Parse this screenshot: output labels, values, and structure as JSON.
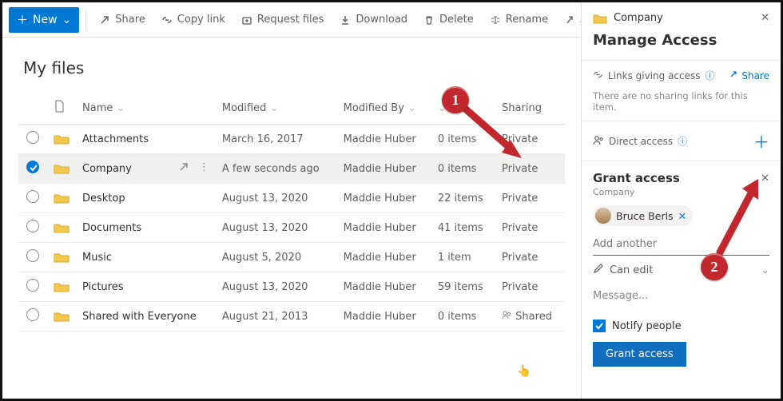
{
  "toolbar": {
    "new_label": "New",
    "share": "Share",
    "copy_link": "Copy link",
    "request_files": "Request files",
    "download": "Download",
    "delete": "Delete",
    "rename": "Rename",
    "automate": "Automate"
  },
  "page": {
    "title": "My files",
    "columns": {
      "name": "Name",
      "modified": "Modified",
      "modified_by": "Modified By",
      "size": "",
      "sharing": "Sharing"
    }
  },
  "rows": [
    {
      "name": "Attachments",
      "modified": "March 16, 2017",
      "by": "Maddie Huber",
      "size": "0 items",
      "sharing": "Private"
    },
    {
      "name": "Company",
      "modified": "A few seconds ago",
      "by": "Maddie Huber",
      "size": "0 items",
      "sharing": "Private"
    },
    {
      "name": "Desktop",
      "modified": "August 13, 2020",
      "by": "Maddie Huber",
      "size": "22 items",
      "sharing": "Private"
    },
    {
      "name": "Documents",
      "modified": "August 13, 2020",
      "by": "Maddie Huber",
      "size": "41 items",
      "sharing": "Private"
    },
    {
      "name": "Music",
      "modified": "August 5, 2020",
      "by": "Maddie Huber",
      "size": "1 item",
      "sharing": "Private"
    },
    {
      "name": "Pictures",
      "modified": "August 13, 2020",
      "by": "Maddie Huber",
      "size": "59 items",
      "sharing": "Private"
    },
    {
      "name": "Shared with Everyone",
      "modified": "August 21, 2013",
      "by": "Maddie Huber",
      "size": "0 items",
      "sharing": "Shared"
    }
  ],
  "panel": {
    "folder": "Company",
    "title": "Manage Access",
    "links_section": "Links giving access",
    "share_label": "Share",
    "no_links": "There are no sharing links for this item.",
    "direct_access": "Direct access"
  },
  "grant": {
    "title": "Grant access",
    "subtitle": "Company",
    "person": "Bruce Berls",
    "add_placeholder": "Add another",
    "permission": "Can edit",
    "message_placeholder": "Message...",
    "notify": "Notify people",
    "button": "Grant access"
  },
  "callouts": {
    "one": "1",
    "two": "2"
  }
}
